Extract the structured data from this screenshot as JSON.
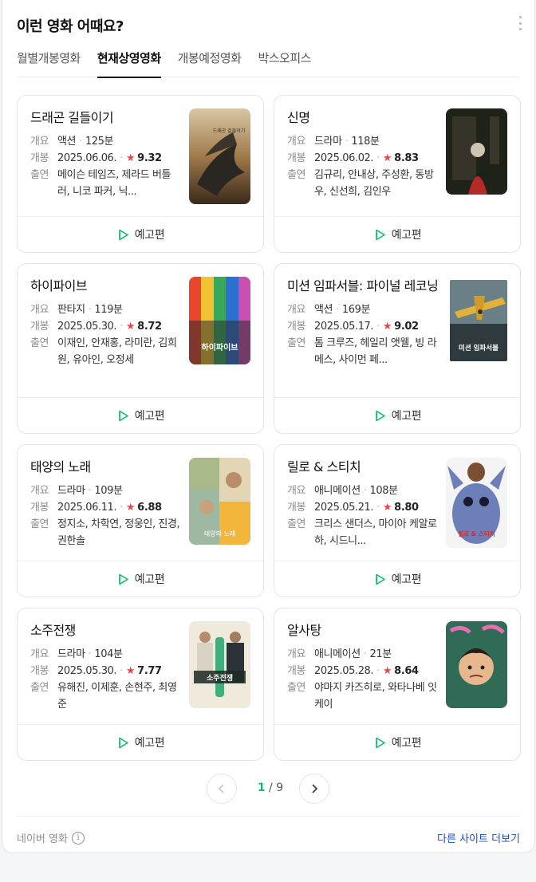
{
  "header": {
    "title": "이런 영화 어때요?"
  },
  "tabs": [
    {
      "label": "월별개봉영화"
    },
    {
      "label": "현재상영영화"
    },
    {
      "label": "개봉예정영화"
    },
    {
      "label": "박스오피스"
    }
  ],
  "labels": {
    "genre": "개요",
    "release": "개봉",
    "cast": "출연",
    "trailer": "예고편",
    "star": "★"
  },
  "movies": [
    {
      "title": "드래곤 길들이기",
      "genre": "액션",
      "runtime": "125분",
      "date": "2025.06.06.",
      "rating": "9.32",
      "cast": "메이슨 테임즈, 제라드 버틀러, 니코 파커, 닉..."
    },
    {
      "title": "신명",
      "genre": "드라마",
      "runtime": "118분",
      "date": "2025.06.02.",
      "rating": "8.83",
      "cast": "김규리, 안내상, 주성환, 동방우, 신선희, 김인우"
    },
    {
      "title": "하이파이브",
      "genre": "판타지",
      "runtime": "119분",
      "date": "2025.05.30.",
      "rating": "8.72",
      "cast": "이재인, 안재홍, 라미란, 김희원, 유아인, 오정세"
    },
    {
      "title": "미션 임파서블: 파이널 레코닝",
      "genre": "액션",
      "runtime": "169분",
      "date": "2025.05.17.",
      "rating": "9.02",
      "cast": "톰 크루즈, 헤일리 앳웰, 빙 라메스, 사이먼 페..."
    },
    {
      "title": "태양의 노래",
      "genre": "드라마",
      "runtime": "109분",
      "date": "2025.06.11.",
      "rating": "6.88",
      "cast": "정지소, 차학연, 정웅인, 진경, 권한솔"
    },
    {
      "title": "릴로 & 스티치",
      "genre": "애니메이션",
      "runtime": "108분",
      "date": "2025.05.21.",
      "rating": "8.80",
      "cast": "크리스 샌더스, 마이아 케알로하, 시드니..."
    },
    {
      "title": "소주전쟁",
      "genre": "드라마",
      "runtime": "104분",
      "date": "2025.05.30.",
      "rating": "7.77",
      "cast": "유해진, 이제훈, 손현주, 최영준"
    },
    {
      "title": "알사탕",
      "genre": "애니메이션",
      "runtime": "21분",
      "date": "2025.05.28.",
      "rating": "8.64",
      "cast": "야마지 카즈히로, 와타나베 잇케이"
    }
  ],
  "posters": {
    "p0": {
      "text": "드래곤 길들이기"
    },
    "p2": {
      "text": "하이파이브"
    },
    "p3": {
      "text": "미션 임파서블"
    },
    "p4": {
      "text": "태양의 노래"
    },
    "p5": {
      "text": "릴로 & 스티치"
    },
    "p6": {
      "text": "소주전쟁"
    }
  },
  "pagination": {
    "current": "1",
    "separator": "/",
    "total": "9"
  },
  "footer": {
    "source": "네이버 영화",
    "more_link": "다른 사이트 더보기"
  },
  "colors": {
    "accent_green": "#0bbd6a",
    "star_red": "#f0424b",
    "link_blue": "#1a4dc9"
  }
}
